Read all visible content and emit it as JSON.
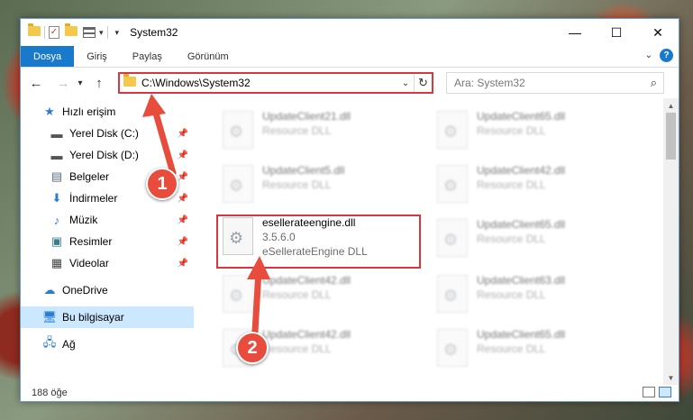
{
  "window": {
    "title": "System32",
    "controls": {
      "minimize": "—",
      "maximize": "☐",
      "close": "✕"
    }
  },
  "ribbon": {
    "tabs": [
      "Dosya",
      "Giriş",
      "Paylaş",
      "Görünüm"
    ],
    "help": "?"
  },
  "nav_buttons": {
    "back": "←",
    "forward": "→",
    "recent": "▾",
    "up": "↑"
  },
  "address": {
    "path": "C:\\Windows\\System32",
    "refresh": "↻"
  },
  "search": {
    "placeholder": "Ara: System32",
    "icon": "⌕"
  },
  "sidebar": {
    "quick_access": "Hızlı erişim",
    "items": [
      {
        "label": "Yerel Disk (C:)",
        "icon": "drive-icon",
        "pinned": true
      },
      {
        "label": "Yerel Disk (D:)",
        "icon": "drive-icon",
        "pinned": true
      },
      {
        "label": "Belgeler",
        "icon": "documents-icon",
        "pinned": true
      },
      {
        "label": "İndirmeler",
        "icon": "downloads-icon",
        "pinned": true
      },
      {
        "label": "Müzik",
        "icon": "music-icon",
        "pinned": true
      },
      {
        "label": "Resimler",
        "icon": "pictures-icon",
        "pinned": true
      },
      {
        "label": "Videolar",
        "icon": "videos-icon",
        "pinned": true
      }
    ],
    "onedrive": "OneDrive",
    "this_pc": "Bu bilgisayar",
    "network": "Ağ"
  },
  "files": {
    "highlighted": {
      "name": "esellerateengine.dll",
      "version": "3.5.6.0",
      "description": "eSellerateEngine DLL"
    },
    "left_col": [
      {
        "name": "UpdateClient21.dll",
        "type": "Resource DLL"
      },
      {
        "name": "UpdateClient5.dll",
        "type": "Resource DLL"
      },
      {
        "name": "UpdateClient42.dll",
        "type": "Resource DLL"
      },
      {
        "name": "UpdateClient42.dll",
        "type": "Resource DLL"
      }
    ],
    "right_col": [
      {
        "name": "UpdateClient65.dll",
        "type": "Resource DLL"
      },
      {
        "name": "UpdateClient42.dll",
        "type": "Resource DLL"
      },
      {
        "name": "UpdateClient65.dll",
        "type": "Resource DLL"
      },
      {
        "name": "UpdateClient63.dll",
        "type": "Resource DLL"
      },
      {
        "name": "UpdateClient65.dll",
        "type": "Resource DLL"
      }
    ]
  },
  "status": {
    "count": "188 öğe"
  },
  "annotations": {
    "step1": "1",
    "step2": "2"
  },
  "colors": {
    "accent": "#1979ca",
    "highlight": "#d9363e",
    "selection": "#cce8ff"
  }
}
